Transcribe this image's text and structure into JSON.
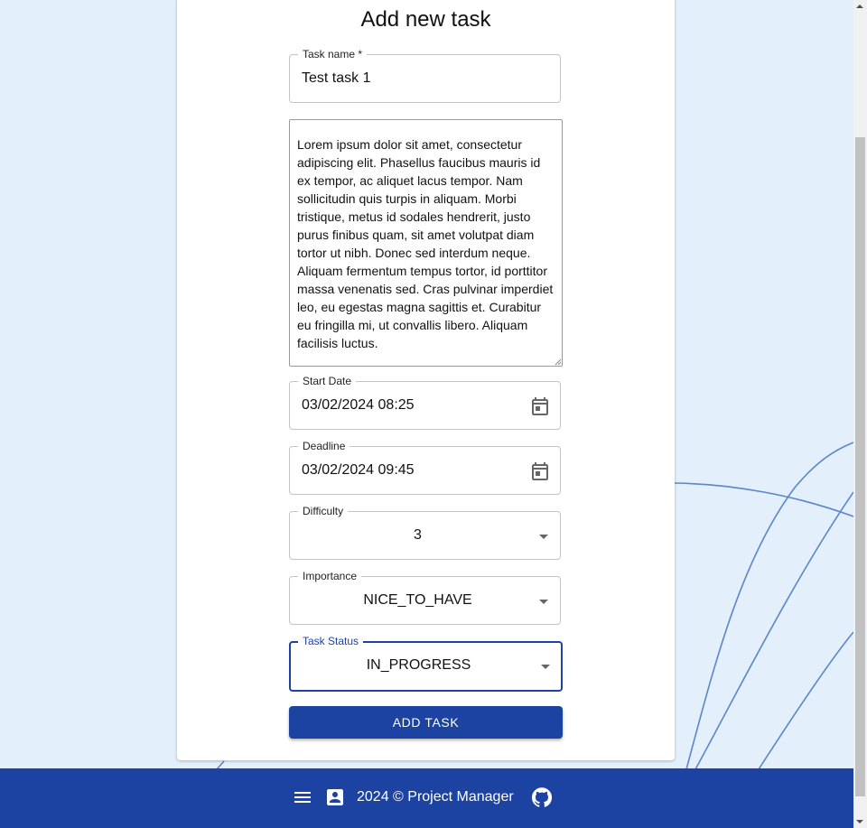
{
  "form": {
    "title": "Add new task",
    "task_name": {
      "label": "Task name *",
      "value": "Test task 1"
    },
    "description": {
      "value": "Lorem ipsum dolor sit amet, consectetur adipiscing elit. Phasellus faucibus mauris id ex tempor, ac aliquet lacus tempor. Nam sollicitudin quis turpis in aliquam. Morbi tristique, metus id sodales hendrerit, justo purus finibus quam, sit amet volutpat diam tortor ut nibh. Donec sed interdum neque. Aliquam fermentum tempus tortor, id porttitor massa venenatis sed. Cras pulvinar imperdiet leo, eu egestas magna sagittis et. Curabitur eu fringilla mi, ut convallis libero. Aliquam facilisis luctus."
    },
    "start_date": {
      "label": "Start Date",
      "value": "03/02/2024 08:25",
      "icon": "calendar-icon"
    },
    "deadline": {
      "label": "Deadline",
      "value": "03/02/2024 09:45",
      "icon": "calendar-icon"
    },
    "difficulty": {
      "label": "Difficulty",
      "value": "3"
    },
    "importance": {
      "label": "Importance",
      "value": "NICE_TO_HAVE"
    },
    "task_status": {
      "label": "Task Status",
      "value": "IN_PROGRESS"
    },
    "submit_label": "ADD TASK"
  },
  "footer": {
    "copyright": "2024 © Project Manager",
    "icons": [
      "menu-icon",
      "contact-icon",
      "github-icon"
    ]
  },
  "colors": {
    "primary": "#1c43a2",
    "background": "#e3f0fc",
    "decor_lines": "#5b86c9"
  }
}
